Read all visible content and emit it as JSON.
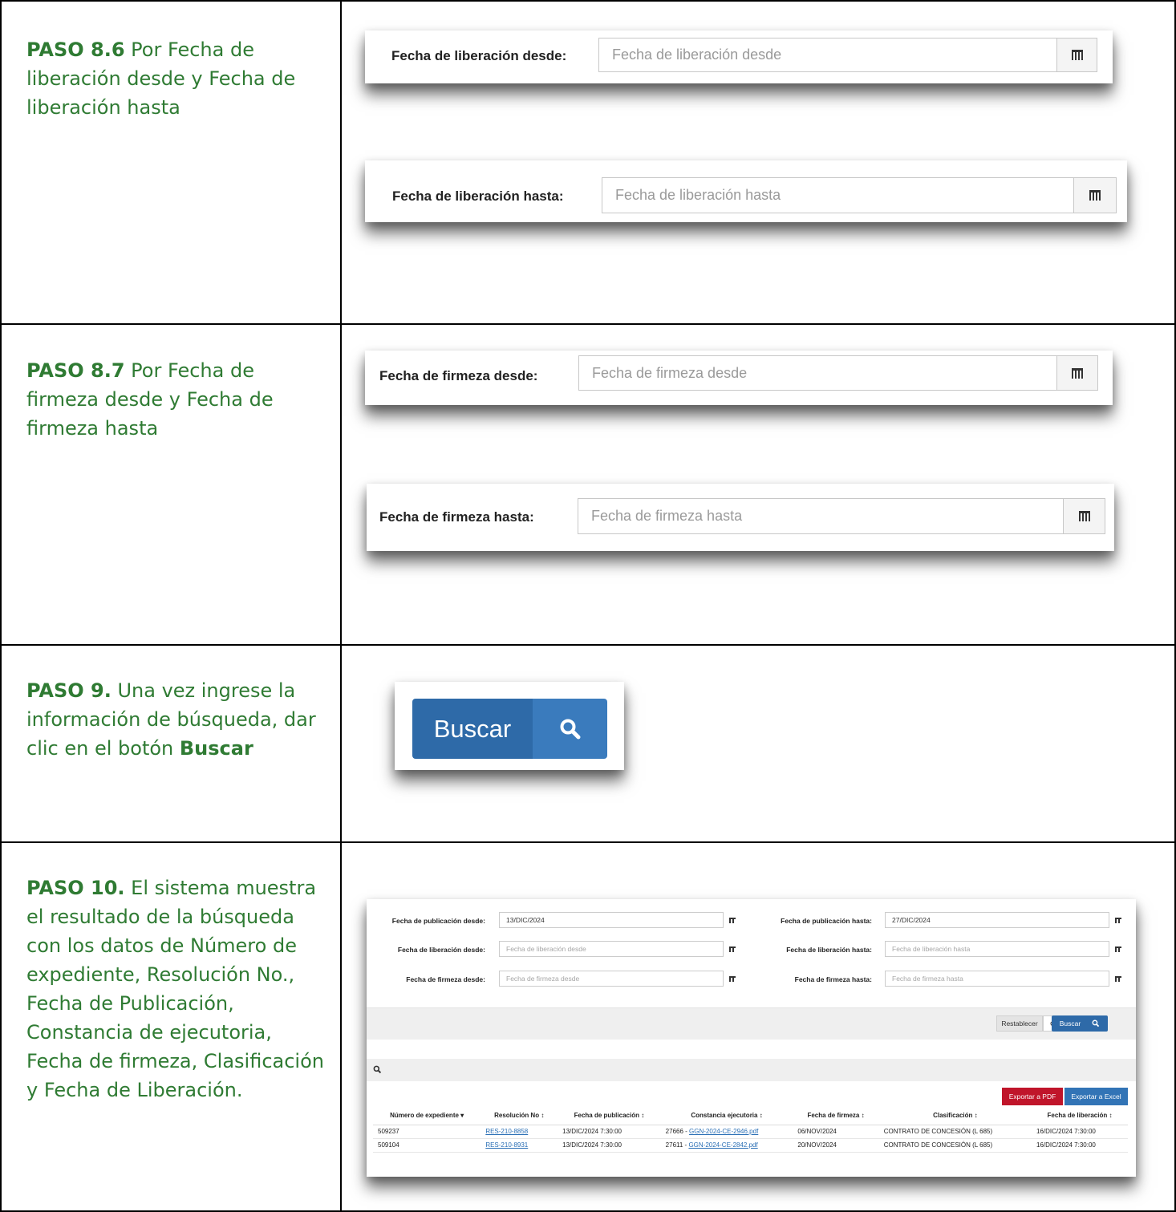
{
  "steps": [
    {
      "id": "8.6",
      "bold": "PASO 8.6",
      "text": " Por Fecha de liberación desde y Fecha de liberación hasta"
    },
    {
      "id": "8.7",
      "bold": "PASO 8.7",
      "text": " Por Fecha de firmeza desde y Fecha de firmeza hasta"
    },
    {
      "id": "9",
      "bold": "PASO 9.",
      "text_before": " Una vez ingrese la información de búsqueda, dar clic en el botón ",
      "bold_end": "Buscar"
    },
    {
      "id": "10",
      "bold": "PASO 10.",
      "text": " El sistema muestra el resultado de la búsqueda con los datos de Número de expediente, Resolución No., Fecha de Publicación, Constancia de ejecutoria, Fecha de firmeza, Clasificación y Fecha de Liberación."
    }
  ],
  "fields": {
    "liberacion_desde": {
      "label": "Fecha de liberación desde:",
      "placeholder": "Fecha de liberación desde"
    },
    "liberacion_hasta": {
      "label": "Fecha de liberación hasta:",
      "placeholder": "Fecha de liberación hasta"
    },
    "firmeza_desde": {
      "label": "Fecha de firmeza desde:",
      "placeholder": "Fecha de firmeza desde"
    },
    "firmeza_hasta": {
      "label": "Fecha de firmeza hasta:",
      "placeholder": "Fecha de firmeza hasta"
    }
  },
  "buscar_button": {
    "label": "Buscar",
    "icon": "search-icon"
  },
  "results": {
    "filters": {
      "pub_desde": {
        "label": "Fecha de publicación desde:",
        "value": "13/DIC/2024"
      },
      "pub_hasta": {
        "label": "Fecha de publicación hasta:",
        "value": "27/DIC/2024"
      },
      "lib_desde": {
        "label": "Fecha de liberación desde:",
        "placeholder": "Fecha de liberación desde"
      },
      "lib_hasta": {
        "label": "Fecha de liberación hasta:",
        "placeholder": "Fecha de liberación hasta"
      },
      "fir_desde": {
        "label": "Fecha de firmeza desde:",
        "placeholder": "Fecha de firmeza desde"
      },
      "fir_hasta": {
        "label": "Fecha de firmeza hasta:",
        "placeholder": "Fecha de firmeza hasta"
      }
    },
    "restablecer": "Restablecer",
    "buscar": "Buscar",
    "export_pdf": "Exportar a PDF",
    "export_excel": "Exportar a Excel",
    "colors": {
      "pdf": "#c0152a",
      "excel": "#3274b6",
      "buscar": "#2e6aa8"
    },
    "columns": [
      "Número de expediente",
      "Resolución No",
      "Fecha de publicación",
      "Constancia ejecutoria",
      "Fecha de firmeza",
      "Clasificación",
      "Fecha de liberación"
    ],
    "rows": [
      {
        "expediente": "509237",
        "resolucion": "RES-210-8858",
        "publicacion": "13/DIC/2024 7:30:00",
        "constancia_num": "27666 - ",
        "constancia_file": "GGN-2024-CE-2946.pdf",
        "firmeza": "06/NOV/2024",
        "clasificacion": "CONTRATO DE CONCESIÓN (L 685)",
        "liberacion": "16/DIC/2024 7:30:00"
      },
      {
        "expediente": "509104",
        "resolucion": "RES-210-8931",
        "publicacion": "13/DIC/2024 7:30:00",
        "constancia_num": "27611 - ",
        "constancia_file": "GGN-2024-CE-2842.pdf",
        "firmeza": "20/NOV/2024",
        "clasificacion": "CONTRATO DE CONCESIÓN (L 685)",
        "liberacion": "16/DIC/2024 7:30:00"
      }
    ]
  }
}
